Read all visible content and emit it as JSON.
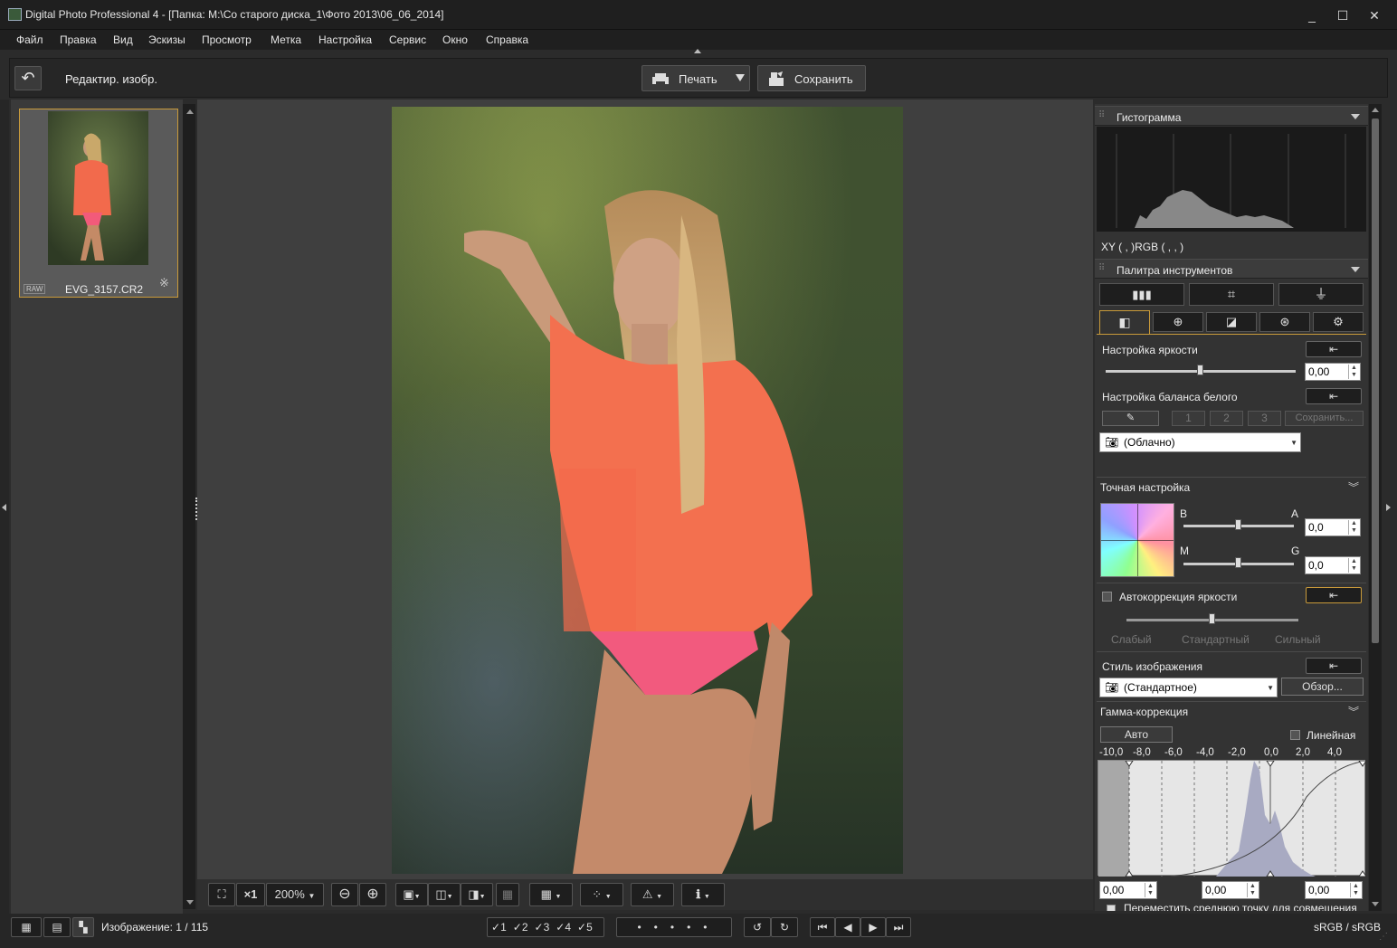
{
  "window": {
    "title": "Digital Photo Professional 4 - [Папка: M:\\Со старого диска_1\\Фото 2013\\06_06_2014]",
    "minimize": "_",
    "maximize": "☐",
    "close": "✕"
  },
  "menu": [
    "Файл",
    "Правка",
    "Вид",
    "Эскизы",
    "Просмотр",
    "Метка",
    "Настройка",
    "Сервис",
    "Окно",
    "Справка"
  ],
  "toolbar": {
    "back_icon": "↶",
    "mode_label": "Редактир. изобр.",
    "print_label": "Печать",
    "save_label": "Сохранить"
  },
  "thumbnail": {
    "raw_badge": "RAW",
    "filename": "EVG_3157.CR2"
  },
  "viewer_toolbar": {
    "fit": "⛶",
    "x1": "×1",
    "zoom": "200%"
  },
  "histogram": {
    "title": "Гистограмма",
    "readout": "XY (    ,     )RGB (   ,   ,    )"
  },
  "tool_palette": {
    "title": "Палитра инструментов",
    "brightness": {
      "label": "Настройка яркости",
      "value": "0,00",
      "level": 0.5
    },
    "white_balance": {
      "label": "Настройка баланса белого",
      "presets": [
        "1",
        "2",
        "3"
      ],
      "save": "Сохранить...",
      "selected": "(Облачно)"
    },
    "fine_tune": {
      "label": "Точная настройка",
      "b_label": "B",
      "a_label": "A",
      "m_label": "M",
      "g_label": "G",
      "ba_value": "0,0",
      "mg_value": "0,0"
    },
    "auto_brightness": {
      "label": "Автокоррекция яркости",
      "levels": [
        "Слабый",
        "Стандартный",
        "Сильный"
      ]
    },
    "picture_style": {
      "label": "Стиль изображения",
      "selected": "(Стандартное)",
      "browse": "Обзор..."
    },
    "gamma": {
      "label": "Гамма-коррекция",
      "auto": "Авто",
      "linear": "Линейная",
      "ticks": [
        "-10,0",
        "-8,0",
        "-6,0",
        "-4,0",
        "-2,0",
        "0,0",
        "2,0",
        "4,0"
      ],
      "values": [
        "0,00",
        "0,00",
        "0,00"
      ],
      "cut_text": "Переместить среднюю точку для совмещения"
    }
  },
  "status": {
    "image_count": "Изображение: 1 / 115",
    "ratings": [
      "1",
      "2",
      "3",
      "4",
      "5"
    ],
    "color_space": "sRGB / sRGB"
  }
}
